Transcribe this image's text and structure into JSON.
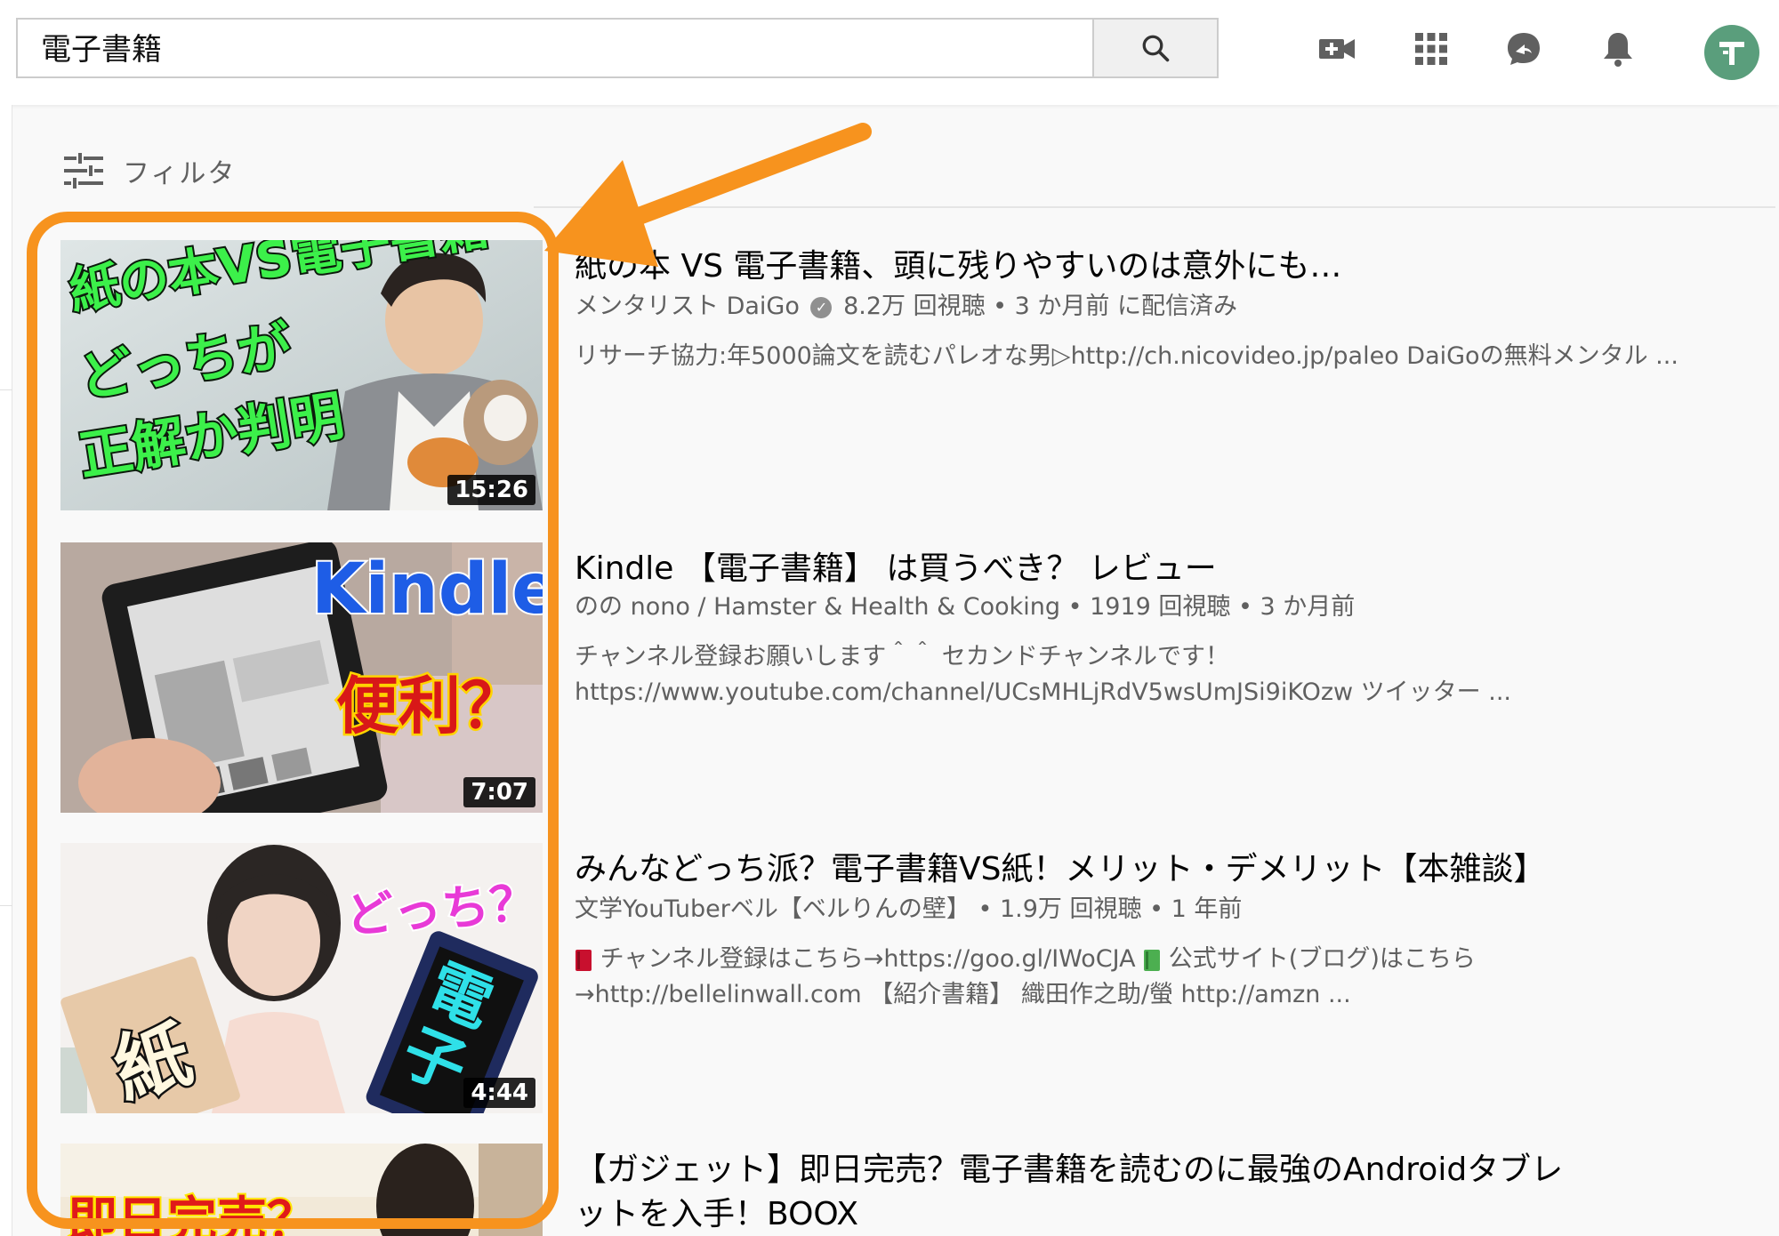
{
  "search": {
    "query": "電子書籍"
  },
  "filter": {
    "label": "フィルタ"
  },
  "results": [
    {
      "title": "紙の本 VS 電子書籍、頭に残りやすいのは意外にも…",
      "channel": "メンタリスト DaiGo",
      "meta": "8.2万 回視聴 • 3 か月前 に配信済み",
      "desc1": "リサーチ協力:年5000論文を読むパレオな男▷http://ch.nicovideo.jp/paleo DaiGoの無料メンタル ...",
      "desc2": "",
      "duration": "15:26",
      "thumb_text": [
        "紙の本VS電子書籍",
        "どっちが",
        "正解か判明"
      ]
    },
    {
      "title": "Kindle 【電子書籍】 は買うべき？ レビュー",
      "channel": "",
      "meta": "のの nono / Hamster & Health & Cooking • 1919 回視聴 • 3 か月前",
      "desc1": "チャンネル登録お願いします＾＾ セカンドチャンネルです！",
      "desc2": "https://www.youtube.com/channel/UCsMHLjRdV5wsUmJSi9iKOzw ツイッター ...",
      "duration": "7:07",
      "thumb_text": [
        "Kindle",
        "便利？"
      ]
    },
    {
      "title": "みんなどっち派？電子書籍VS紙！メリット・デメリット【本雑談】",
      "channel": "",
      "meta": "文学YouTuberベル【ベルりんの壁】 • 1.9万 回視聴 • 1 年前",
      "desc1a": " チャンネル登録はこちら→https://goo.gl/IWoCJA ",
      "desc1b": " 公式サイト(ブログ)はこちら",
      "desc2": "→http://bellelinwall.com 【紹介書籍】 織田作之助/螢 http://amzn ...",
      "duration": "4:44",
      "thumb_text": [
        "どっち？",
        "紙",
        "電子"
      ]
    },
    {
      "title_line1": "【ガジェット】即日完売？電子書籍を読むのに最強のAndroidタブレ",
      "title_line2": "ットを入手！BOOX",
      "thumb_text": [
        "即日完売？"
      ]
    }
  ],
  "colors": {
    "accent": "#f7931e",
    "avatar": "#5a9e7c",
    "text_primary": "#030303",
    "text_secondary": "#606060"
  },
  "icons": [
    "search-icon",
    "create-video-icon",
    "apps-icon",
    "messages-icon",
    "notifications-icon",
    "filter-icon",
    "verified-icon"
  ]
}
